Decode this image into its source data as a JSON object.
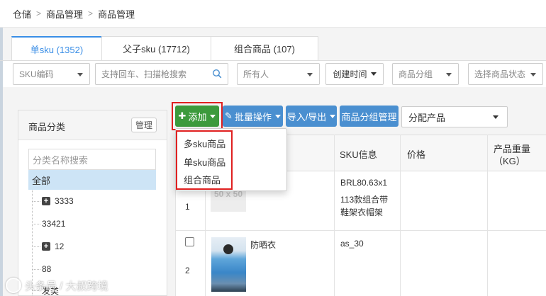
{
  "breadcrumb": [
    "仓储",
    "商品管理",
    "商品管理"
  ],
  "tabs": [
    {
      "label": "单sku (1352)",
      "active": true
    },
    {
      "label": "父子sku (17712)",
      "active": false
    },
    {
      "label": "组合商品 (107)",
      "active": false
    }
  ],
  "filters": {
    "sku_code": "SKU编码",
    "search_placeholder": "支持回车、扫描枪搜索",
    "owner": "所有人",
    "created_time": "创建时间",
    "product_group": "商品分组",
    "product_status": "选择商品状态"
  },
  "category": {
    "title": "商品分类",
    "manage": "管理",
    "search_placeholder": "分类名称搜索",
    "all": "全部",
    "nodes": [
      "3333",
      "33421",
      "12",
      "88",
      "发类"
    ]
  },
  "toolbar": {
    "add": "添加",
    "batch": "批量操作",
    "import_export": "导入/导出",
    "group_manage": "商品分组管理",
    "assign": "分配产品"
  },
  "add_menu": [
    "多sku商品",
    "单sku商品",
    "组合商品"
  ],
  "table": {
    "headers": {
      "sku_info": "SKU信息",
      "price": "价格",
      "weight_line1": "产品重量",
      "weight_line2": "（KG）"
    },
    "rows": [
      {
        "index": "1",
        "image_placeholder": "50 x 50",
        "name": "",
        "sku_line1": "BRL80.63x1",
        "sku_line2": "113款组合带",
        "sku_line3": "鞋架衣帽架"
      },
      {
        "index": "2",
        "image_placeholder": "",
        "name": "防晒衣",
        "sku_line1": "as_30",
        "sku_line2": "",
        "sku_line3": ""
      }
    ]
  },
  "watermark": "头条号 / 大叔跨境",
  "colors": {
    "accent": "#3a8ee6",
    "add_green": "#3c9a3c",
    "button_blue": "#4a8fd0",
    "highlight_red": "#e02020",
    "tree_selected": "#cde4f6"
  }
}
